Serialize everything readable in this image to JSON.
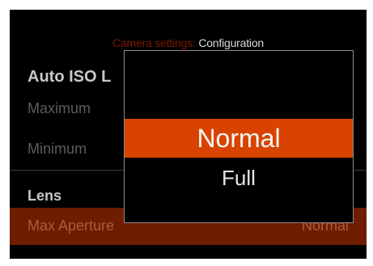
{
  "header": {
    "prefix": "Camera settings:",
    "title": "Configuration"
  },
  "sections": {
    "auto_iso": {
      "title": "Auto ISO L",
      "items": [
        "Maximum",
        "Minimum"
      ]
    },
    "lens": {
      "title": "Lens",
      "selected_item_label": "Max Aperture",
      "selected_item_value": "Normal"
    }
  },
  "popup": {
    "options": [
      "Normal",
      "Full"
    ],
    "selected": "Normal"
  },
  "colors": {
    "background": "#000000",
    "accent": "#d84400",
    "selected_row": "#6e1d00",
    "header_prefix": "#7a1a00"
  }
}
